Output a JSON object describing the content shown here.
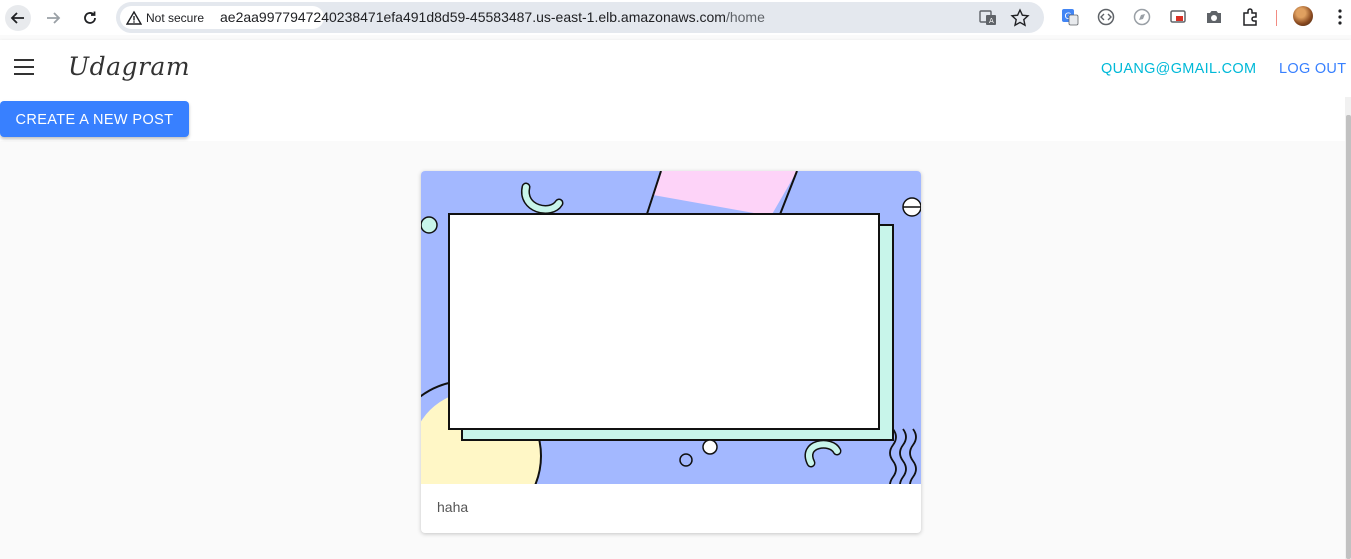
{
  "browser": {
    "security_label": "Not secure",
    "url_host": "ae2aa9977947240238471efa491d8d59-45583487.us-east-1.elb.amazonaws.com",
    "url_path": "/home"
  },
  "header": {
    "brand": "Udagram",
    "user_email": "QUANG@GMAIL.COM",
    "logout_label": "LOG OUT"
  },
  "actions": {
    "create_post_label": "CREATE A NEW POST"
  },
  "posts": [
    {
      "caption": "haha"
    }
  ],
  "colors": {
    "primary": "#3880ff",
    "secondary": "#00b9d8",
    "page_bg": "#fafafa"
  }
}
